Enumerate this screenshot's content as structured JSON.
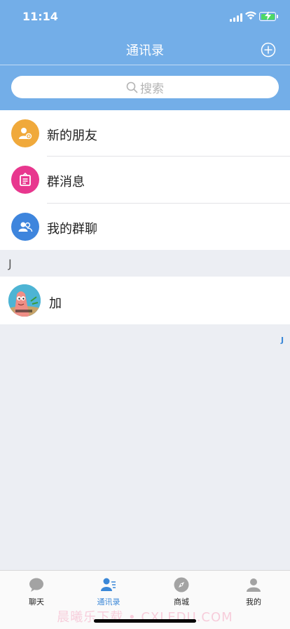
{
  "status_bar": {
    "time": "11:14"
  },
  "nav": {
    "title": "通讯录",
    "add_icon": "plus-circle-icon"
  },
  "search": {
    "placeholder": "搜索"
  },
  "menu": [
    {
      "label": "新的朋友",
      "icon": "new-friend-icon",
      "color": "#f0a93b"
    },
    {
      "label": "群消息",
      "icon": "group-message-icon",
      "color": "#e8378e"
    },
    {
      "label": "我的群聊",
      "icon": "group-chat-icon",
      "color": "#3e85dd"
    }
  ],
  "contacts": {
    "section_letter": "J",
    "items": [
      {
        "name": "加"
      }
    ]
  },
  "side_index": [
    "J"
  ],
  "tabs": [
    {
      "label": "聊天",
      "icon": "chat-icon",
      "active": false
    },
    {
      "label": "通讯录",
      "icon": "contacts-icon",
      "active": true
    },
    {
      "label": "商城",
      "icon": "compass-icon",
      "active": false
    },
    {
      "label": "我的",
      "icon": "profile-icon",
      "active": false
    }
  ],
  "watermark": "晨曦乐下载 • CXLEDU.COM",
  "colors": {
    "header": "#73aee8",
    "accent": "#3a87d7",
    "background": "#eceef3"
  }
}
